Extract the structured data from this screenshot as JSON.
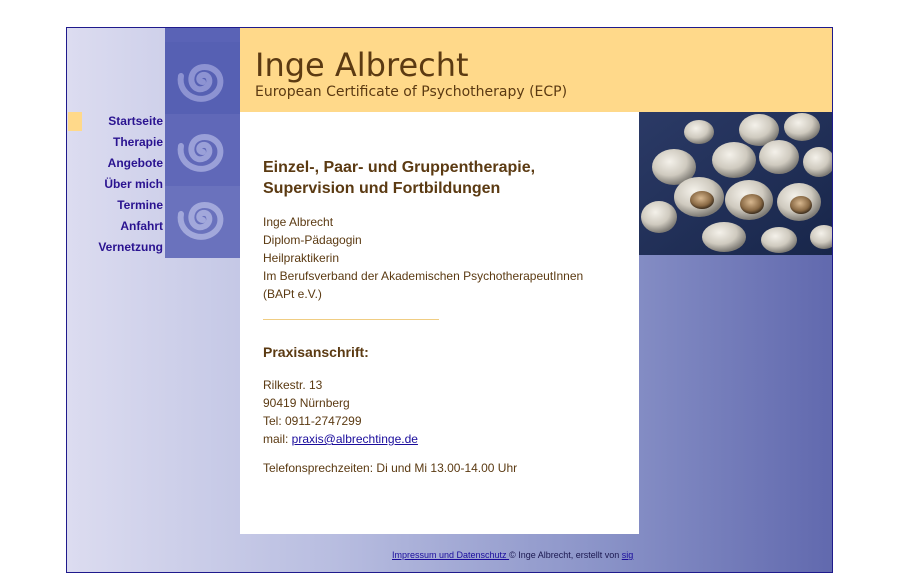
{
  "header": {
    "title": "Inge Albrecht",
    "subtitle": "European Certificate of Psychotherapy (ECP)"
  },
  "nav": {
    "items": [
      {
        "label": "Startseite",
        "active": true
      },
      {
        "label": "Therapie"
      },
      {
        "label": "Angebote"
      },
      {
        "label": "Über mich"
      },
      {
        "label": "Termine"
      },
      {
        "label": "Anfahrt"
      },
      {
        "label": "Vernetzung"
      }
    ]
  },
  "main": {
    "heading_line1": "Einzel-, Paar- und Gruppentherapie,",
    "heading_line2": "Supervision und Fortbildungen",
    "bio": [
      "Inge Albrecht",
      "Diplom-Pädagogin",
      "Heilpraktikerin",
      "Im Berufsverband der Akademischen PsychotherapeutInnen",
      "(BAPt e.V.)"
    ],
    "address_heading": "Praxisanschrift:",
    "address": {
      "street": "Rilkestr. 13",
      "city": "90419 Nürnberg",
      "phone": "Tel: 0911-2747299",
      "mail_prefix": "mail: ",
      "mail_link": "praxis@albrechtinge.de"
    },
    "phone_hours": "Telefonsprechzeiten: Di und Mi 13.00-14.00 Uhr"
  },
  "footer": {
    "impressum_link": "Impressum und Datenschutz ",
    "copyright": " © Inge Albrecht,  erstellt von ",
    "author_link": "sig"
  },
  "colors": {
    "accent": "#ffd98a",
    "text_brown": "#5b3a12",
    "nav_blue": "#2a1390",
    "border": "#1f1a8c"
  }
}
